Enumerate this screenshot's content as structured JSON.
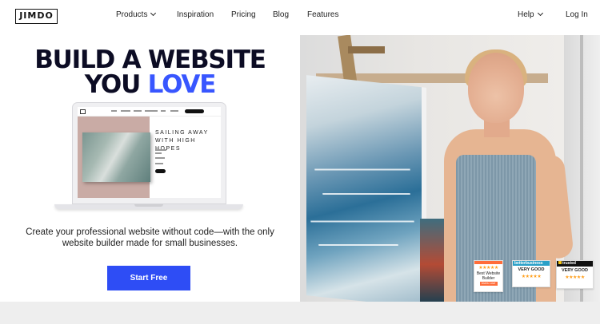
{
  "header": {
    "logo": "JIMDO",
    "nav": {
      "products": "Products",
      "inspiration": "Inspiration",
      "pricing": "Pricing",
      "blog": "Blog",
      "features": "Features",
      "help": "Help",
      "login": "Log In"
    }
  },
  "hero": {
    "headline_line1": "BUILD A WEBSITE",
    "headline_line2_prefix": "YOU",
    "headline_line2_highlight": "LOVE",
    "subtext_line1": "Create your professional website without code—with the only",
    "subtext_line2": "website builder made for small businesses.",
    "cta_label": "Start Free",
    "mockup": {
      "title_line1": "SAILING AWAY",
      "title_line2": "WITH HIGH HOPES"
    }
  },
  "badges": {
    "g2": {
      "stars": "★★★★★",
      "title": "Best Website Builder",
      "tag": "Users Love Us"
    },
    "better_business": {
      "header": "betterbusiness",
      "rating": "VERY GOOD",
      "stars": "★★★★★"
    },
    "trusted": {
      "header": "trusted",
      "rating": "VERY GOOD",
      "stars": "★★★★★"
    }
  },
  "colors": {
    "brand_blue": "#3856ff",
    "cta_blue": "#2e4df5",
    "headline": "#0c0c24"
  }
}
